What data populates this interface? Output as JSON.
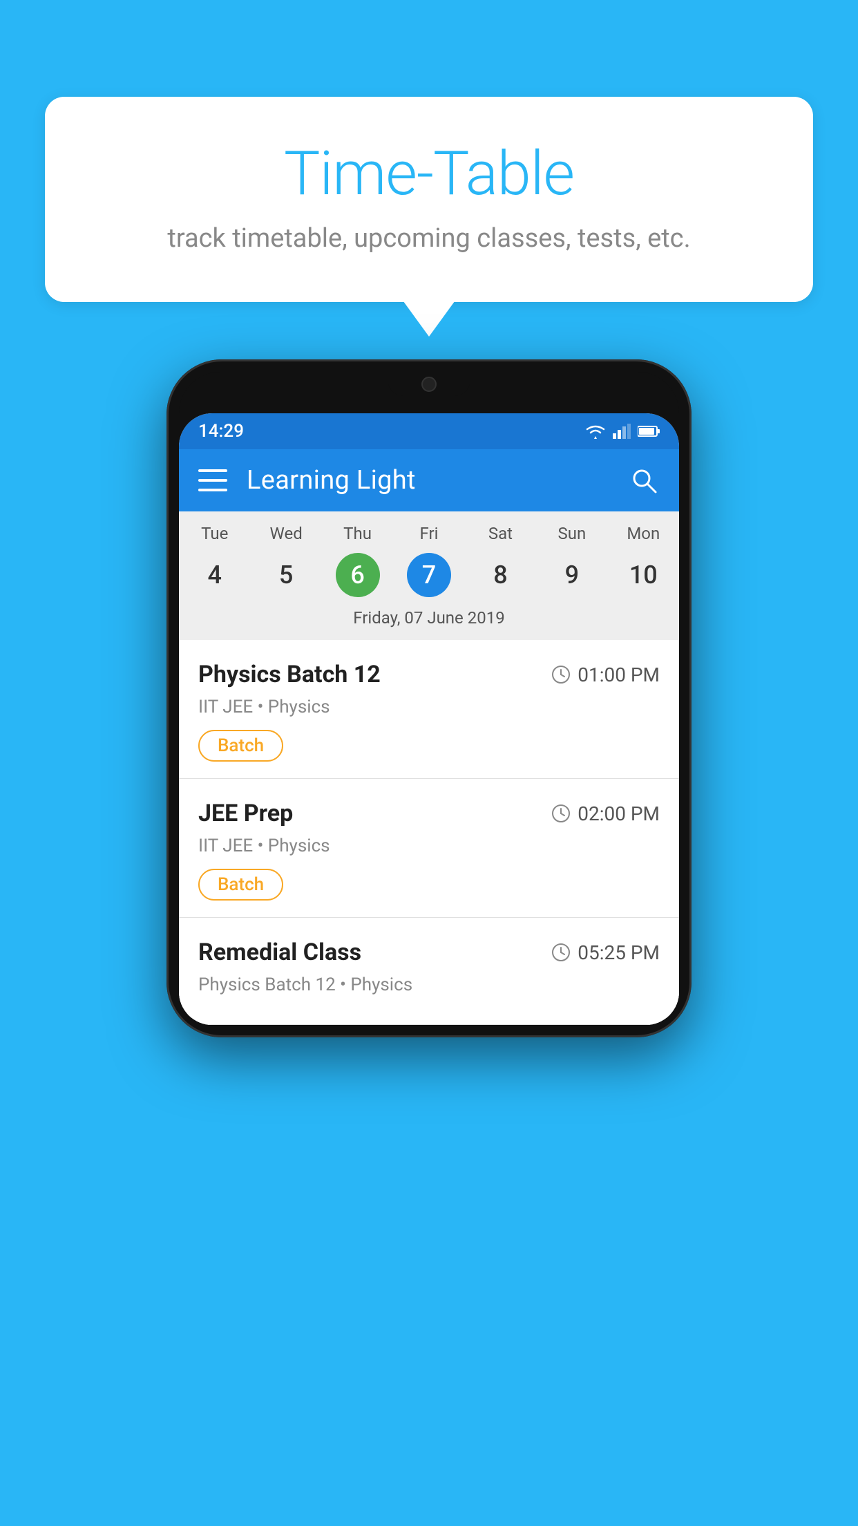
{
  "page": {
    "background_color": "#29B6F6"
  },
  "speech_bubble": {
    "title": "Time-Table",
    "subtitle": "track timetable, upcoming classes, tests, etc."
  },
  "app_bar": {
    "title": "Learning Light",
    "menu_icon": "hamburger-icon",
    "search_icon": "search-icon"
  },
  "status_bar": {
    "time": "14:29"
  },
  "calendar": {
    "selected_date_label": "Friday, 07 June 2019",
    "days": [
      {
        "name": "Tue",
        "num": "4",
        "state": "normal"
      },
      {
        "name": "Wed",
        "num": "5",
        "state": "normal"
      },
      {
        "name": "Thu",
        "num": "6",
        "state": "today"
      },
      {
        "name": "Fri",
        "num": "7",
        "state": "selected"
      },
      {
        "name": "Sat",
        "num": "8",
        "state": "normal"
      },
      {
        "name": "Sun",
        "num": "9",
        "state": "normal"
      },
      {
        "name": "Mon",
        "num": "10",
        "state": "normal"
      }
    ]
  },
  "schedule": {
    "items": [
      {
        "title": "Physics Batch 12",
        "time": "01:00 PM",
        "subtitle": "IIT JEE • Physics",
        "badge": "Batch"
      },
      {
        "title": "JEE Prep",
        "time": "02:00 PM",
        "subtitle": "IIT JEE • Physics",
        "badge": "Batch"
      },
      {
        "title": "Remedial Class",
        "time": "05:25 PM",
        "subtitle": "Physics Batch 12 • Physics",
        "badge": ""
      }
    ]
  }
}
